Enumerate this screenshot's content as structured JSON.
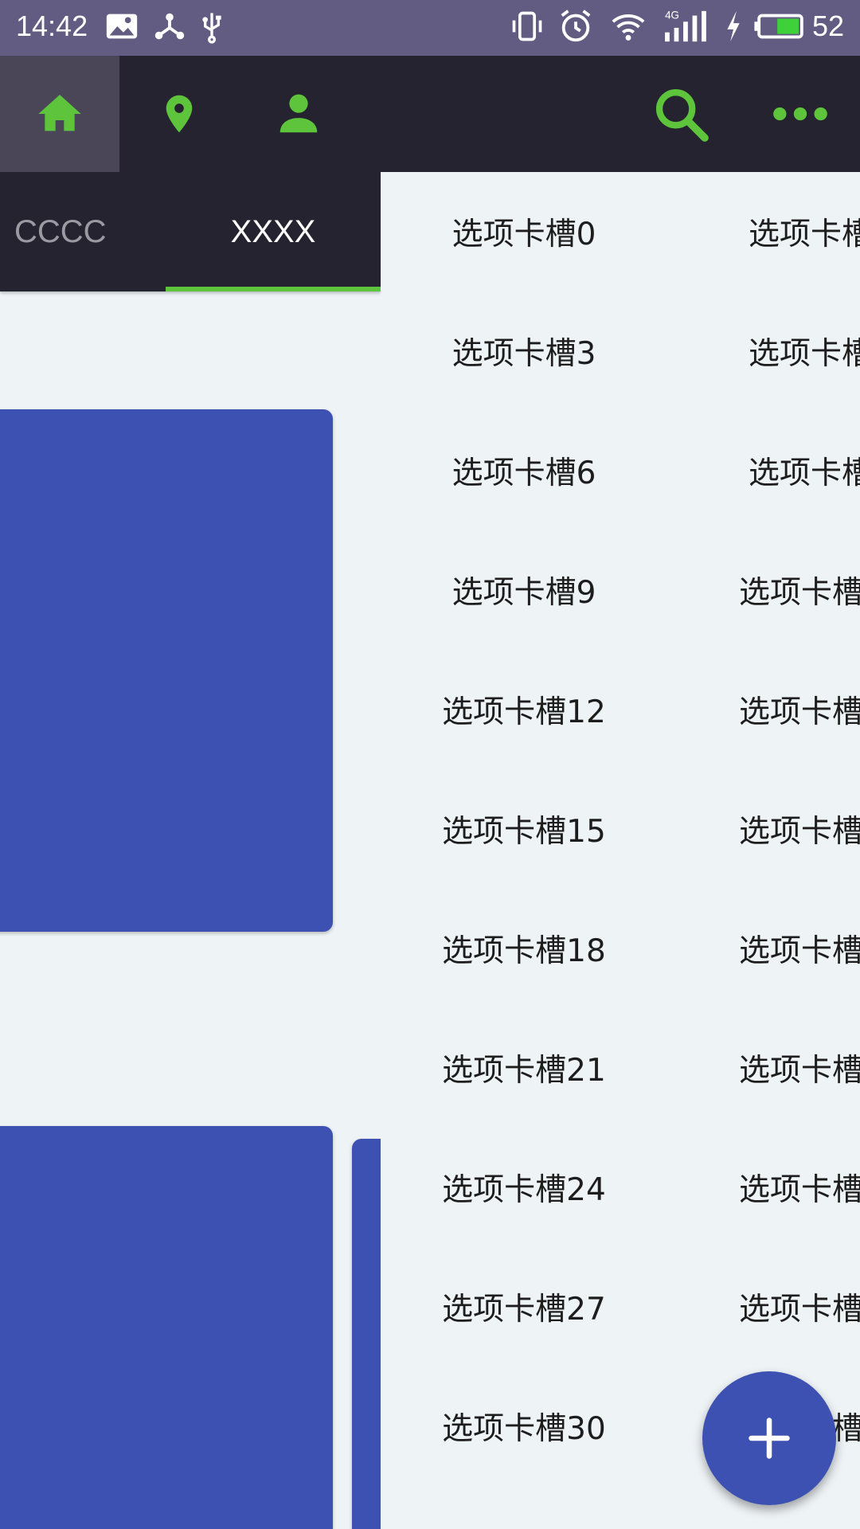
{
  "status_bar": {
    "time": "14:42",
    "battery_level": "52",
    "icons": [
      "image-icon",
      "share-hub-icon",
      "usb-icon",
      "vibrate-icon",
      "alarm-icon",
      "wifi-icon",
      "signal-4g-icon",
      "charging-icon",
      "battery-icon"
    ]
  },
  "toolbar": {
    "accent_color": "#5ec43c",
    "left_icons": [
      "home-icon",
      "location-pin-icon",
      "person-icon"
    ],
    "right_icons": [
      "search-icon",
      "more-dots-icon"
    ]
  },
  "tabs": [
    {
      "label": "CCCC",
      "selected": false
    },
    {
      "label": "XXXX",
      "selected": true
    }
  ],
  "grid": {
    "items": [
      "选项卡槽0",
      "选项卡槽",
      "选项卡槽3",
      "选项卡槽",
      "选项卡槽6",
      "选项卡槽",
      "选项卡槽9",
      "选项卡槽",
      "选项卡槽12",
      "选项卡槽",
      "选项卡槽15",
      "选项卡槽",
      "选项卡槽18",
      "选项卡槽",
      "选项卡槽21",
      "选项卡槽",
      "选项卡槽24",
      "选项卡槽",
      "选项卡槽27",
      "选项卡槽",
      "选项卡槽30",
      "选项卡槽"
    ]
  },
  "fab": {
    "icon": "plus-icon",
    "color": "#3d51b2"
  }
}
